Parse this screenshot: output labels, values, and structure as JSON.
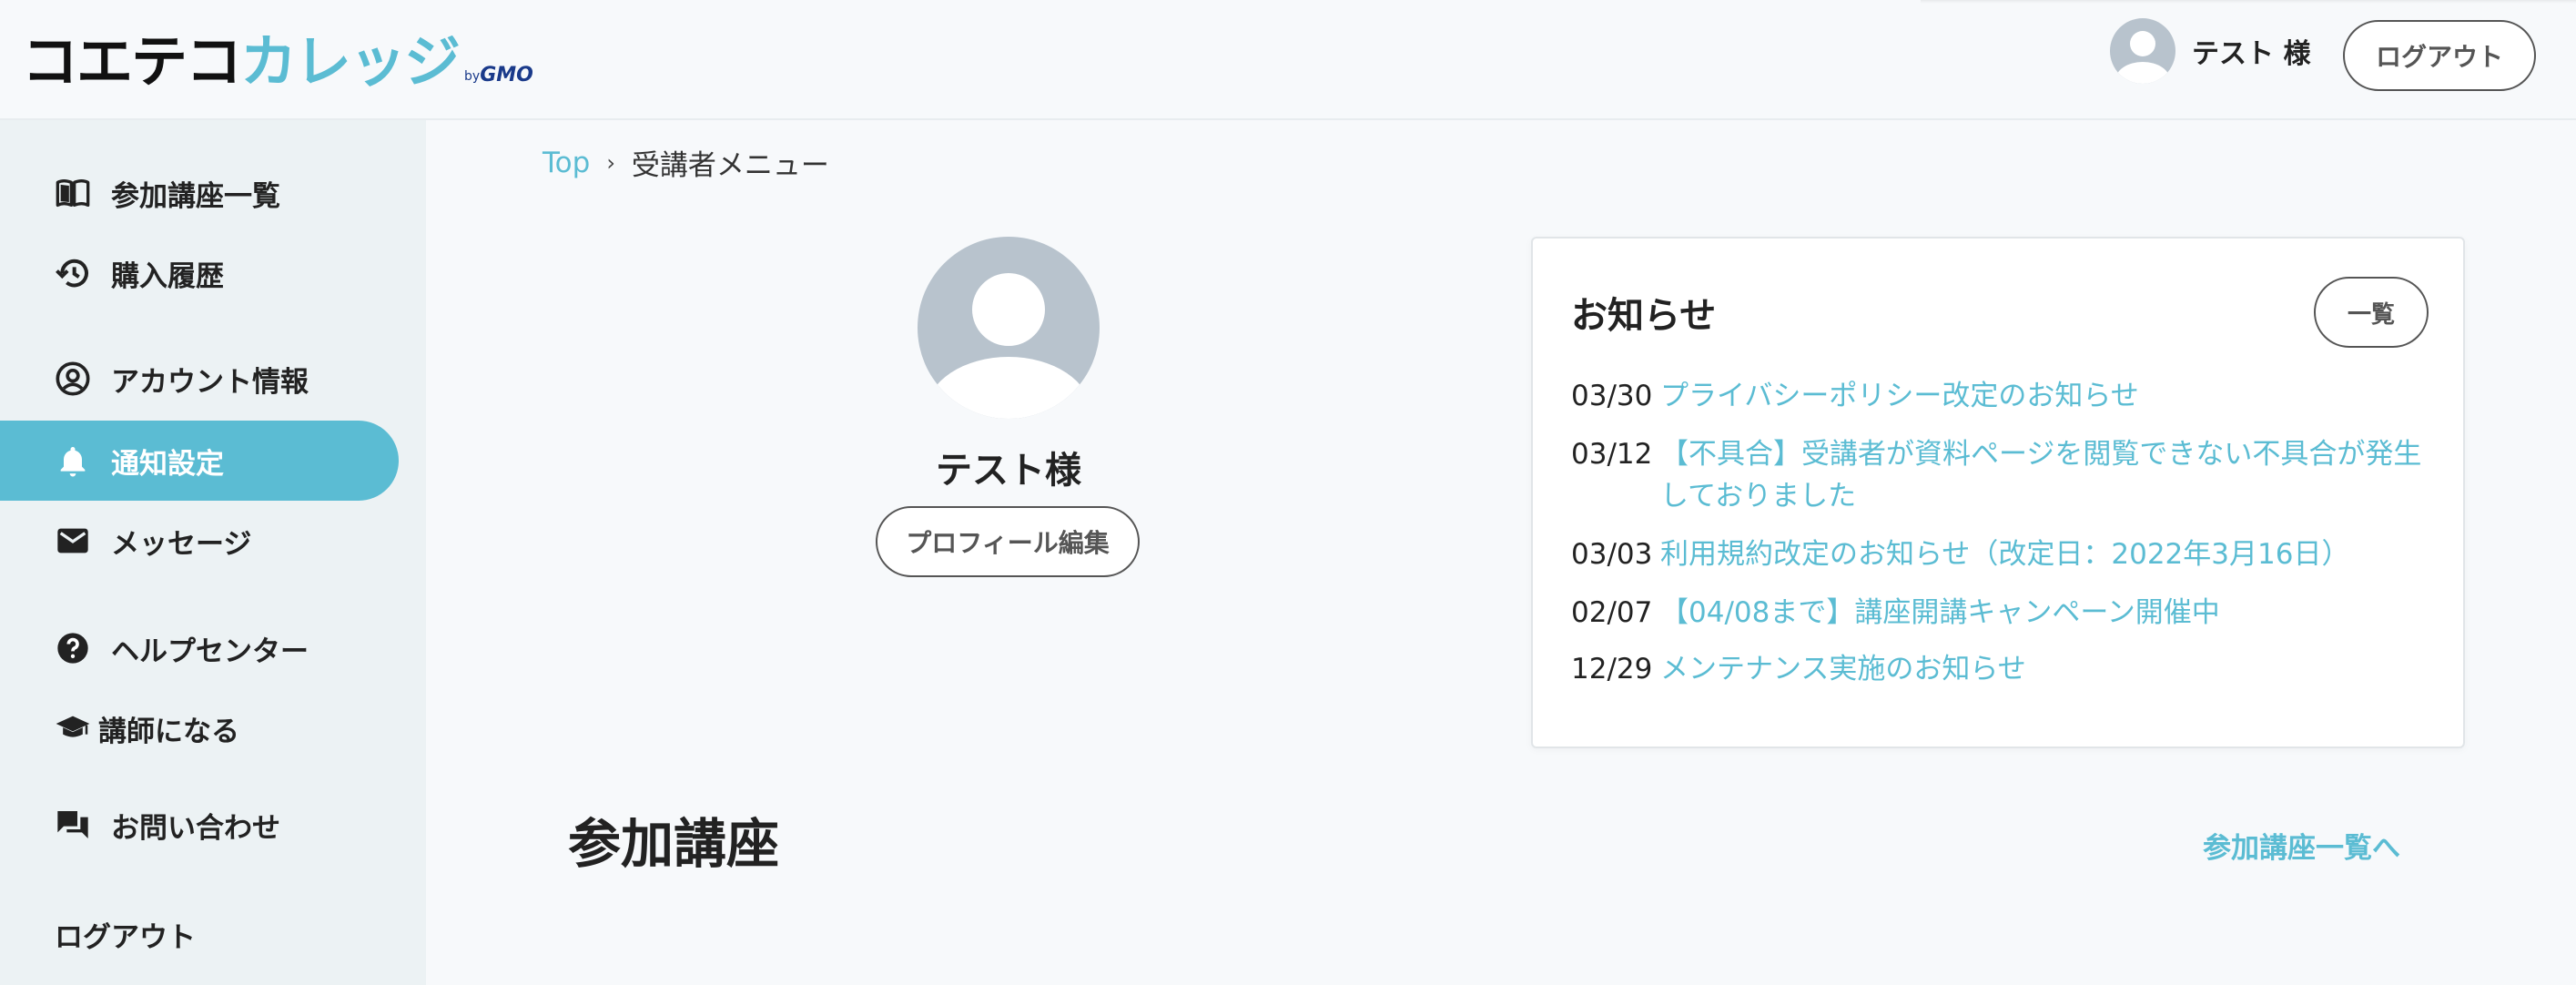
{
  "header": {
    "logo_main": "コエテコ",
    "logo_sub": "カレッジ",
    "logo_by": "by",
    "logo_gmo": "GMO",
    "username": "テスト 様",
    "logout_label": "ログアウト"
  },
  "sidebar": {
    "items": [
      {
        "label": "参加講座一覧",
        "icon": "book-icon"
      },
      {
        "label": "購入履歴",
        "icon": "history-icon"
      },
      {
        "label": "アカウント情報",
        "icon": "account-circle-icon"
      },
      {
        "label": "通知設定",
        "icon": "bell-icon",
        "active": true
      },
      {
        "label": "メッセージ",
        "icon": "mail-icon"
      },
      {
        "label": "ヘルプセンター",
        "icon": "help-icon"
      },
      {
        "label": "講師になる",
        "icon": "graduation-cap-icon"
      },
      {
        "label": "お問い合わせ",
        "icon": "chat-icon"
      },
      {
        "label": "ログアウト"
      }
    ]
  },
  "breadcrumb": {
    "top": "Top",
    "separator": "›",
    "current": "受講者メニュー"
  },
  "profile": {
    "name": "テスト様",
    "edit_label": "プロフィール編集"
  },
  "news": {
    "title": "お知らせ",
    "list_label": "一覧",
    "items": [
      {
        "date": "03/30",
        "text": "プライバシーポリシー改定のお知らせ"
      },
      {
        "date": "03/12",
        "text": "【不具合】受講者が資料ページを閲覧できない不具合が発生しておりました"
      },
      {
        "date": "03/03",
        "text": "利用規約改定のお知らせ（改定日：2022年3月16日）"
      },
      {
        "date": "02/07",
        "text": "【04/08まで】講座開講キャンペーン開催中"
      },
      {
        "date": "12/29",
        "text": "メンテナンス実施のお知らせ"
      }
    ]
  },
  "section": {
    "title": "参加講座",
    "link": "参加講座一覧へ"
  },
  "colors": {
    "accent": "#5bbcd3",
    "sidebar_bg": "#ecf2f4",
    "avatar": "#b8c3cd"
  }
}
